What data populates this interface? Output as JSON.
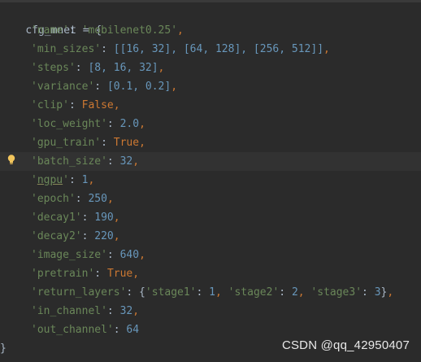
{
  "code": {
    "line1": "cfg_mnet = {",
    "name_key": "'name'",
    "name_val": "'mobilenet0.25'",
    "min_sizes_key": "'min_sizes'",
    "min_sizes_val": "[[16, 32], [64, 128], [256, 512]]",
    "steps_key": "'steps'",
    "steps_val": "[8, 16, 32]",
    "variance_key": "'variance'",
    "variance_val": "[0.1, 0.2]",
    "clip_key": "'clip'",
    "clip_val": "False",
    "loc_weight_key": "'loc_weight'",
    "loc_weight_val": "2.0",
    "gpu_train_key": "'gpu_train'",
    "gpu_train_val": "True",
    "batch_size_key": "'batch_size'",
    "batch_size_val": "32",
    "ngpu_key": "ngpu",
    "ngpu_val": "1",
    "epoch_key": "'epoch'",
    "epoch_val": "250",
    "decay1_key": "'decay1'",
    "decay1_val": "190",
    "decay2_key": "'decay2'",
    "decay2_val": "220",
    "image_size_key": "'image_size'",
    "image_size_val": "640",
    "pretrain_key": "'pretrain'",
    "pretrain_val": "True",
    "return_layers_key": "'return_layers'",
    "rl_stage1_key": "'stage1'",
    "rl_stage1_val": "1",
    "rl_stage2_key": "'stage2'",
    "rl_stage2_val": "2",
    "rl_stage3_key": "'stage3'",
    "rl_stage3_val": "3",
    "in_channel_key": "'in_channel'",
    "in_channel_val": "32",
    "out_channel_key": "'out_channel'",
    "out_channel_val": "64",
    "closing": "}"
  },
  "watermark": "CSDN @qq_42950407",
  "icons": {
    "gutter": "lightbulb-icon"
  },
  "colors": {
    "background": "#2b2b2b",
    "string": "#6a8759",
    "number": "#6897bb",
    "keyword": "#cc7832",
    "text": "#a9b7c6"
  }
}
